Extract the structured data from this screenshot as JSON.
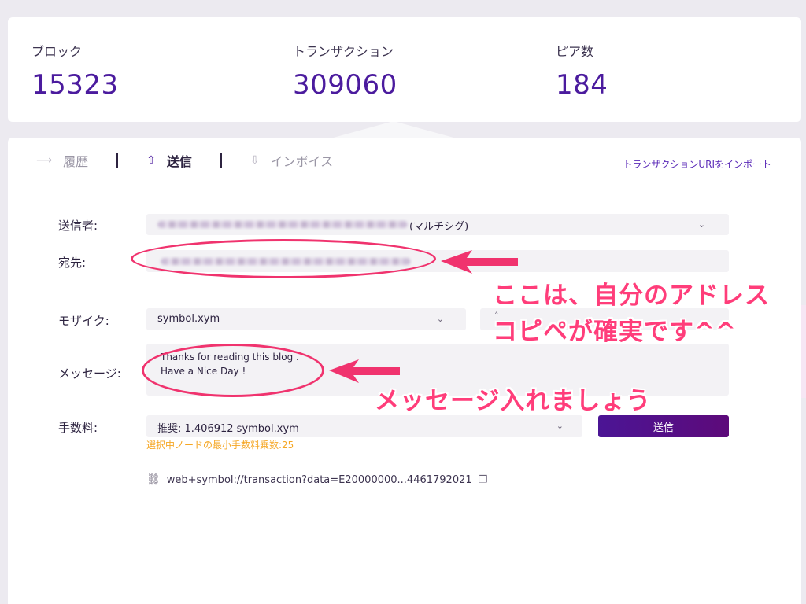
{
  "stats": [
    {
      "label": "ブロック",
      "value": "15323"
    },
    {
      "label": "トランザクション",
      "value": "309060"
    },
    {
      "label": "ピア数",
      "value": "184"
    }
  ],
  "tabs": [
    {
      "label": "履歴",
      "icon": "history-arrow-icon",
      "active": false
    },
    {
      "label": "送信",
      "icon": "upload-icon",
      "active": true
    },
    {
      "label": "インボイス",
      "icon": "download-icon",
      "active": false
    }
  ],
  "import_link": "トランザクションURIをインポート",
  "form": {
    "sender_label": "送信者:",
    "sender_suffix": "(マルチシグ)",
    "recipient_label": "宛先:",
    "mosaic_label": "モザイク:",
    "mosaic_value": "symbol.xym",
    "message_label": "メッセージ:",
    "message_line1": "Thanks for reading this blog .",
    "message_line2": "Have a Nice Day !",
    "fee_label": "手数料:",
    "fee_value": "推奨: 1.406912 symbol.xym",
    "send_button": "送信",
    "fee_note": "選択中ノードの最小手数料乗数:25",
    "uri": "web+symbol://transaction?data=E20000000...4461792021"
  },
  "annotations": {
    "recipient_note_line1": "ここは、自分のアドレス",
    "recipient_note_line2": "コピペが確実です^^",
    "message_note": "メッセージ入れましょう",
    "color": "#ff3d7a"
  }
}
